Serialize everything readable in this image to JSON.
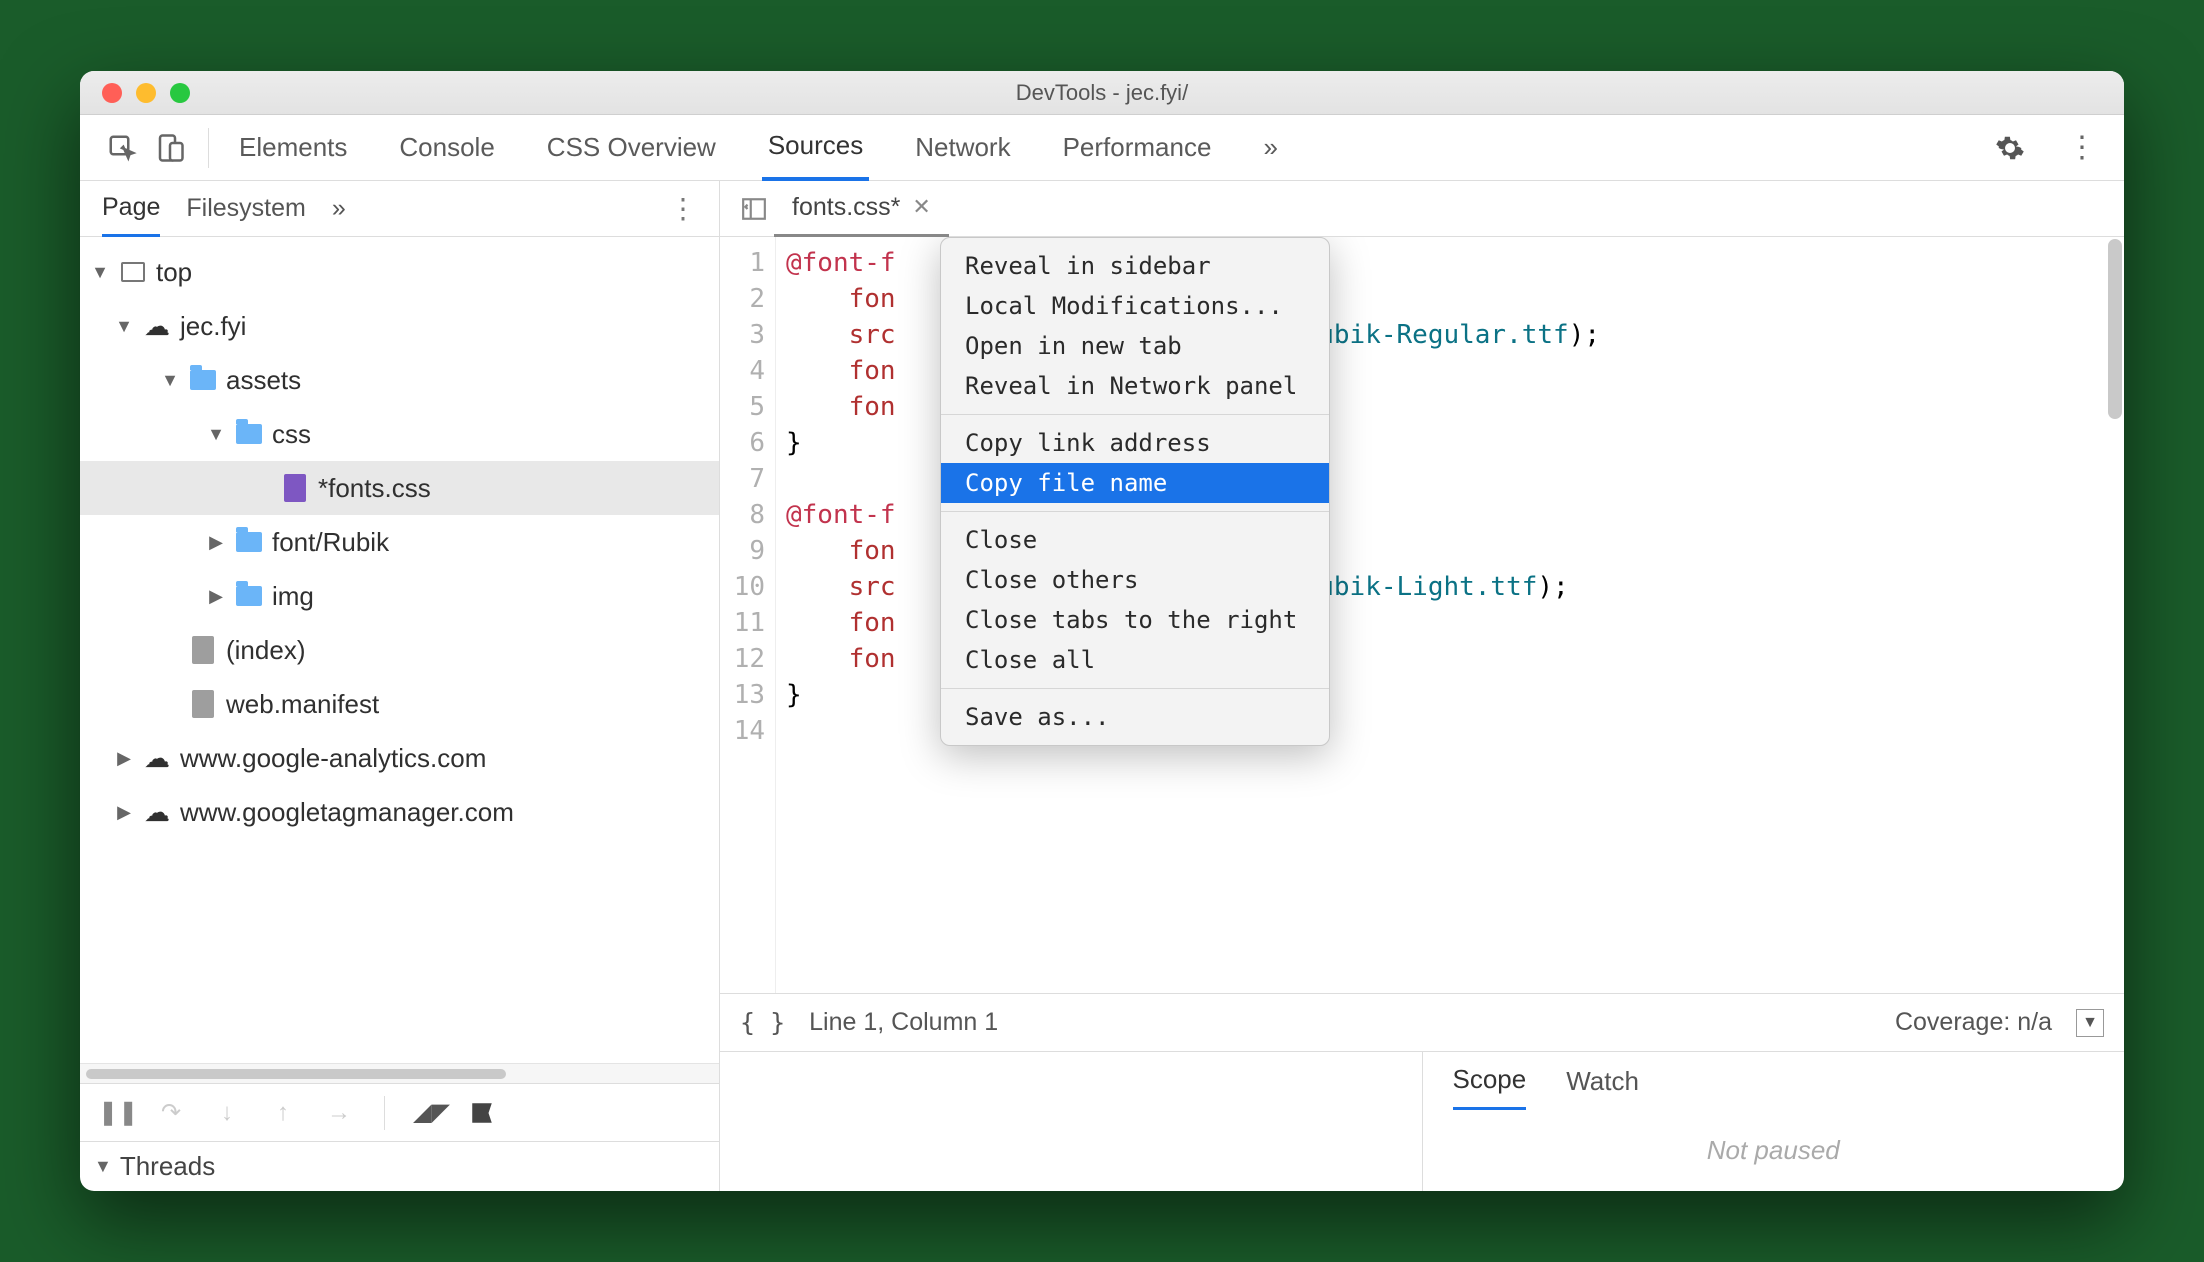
{
  "window": {
    "title": "DevTools - jec.fyi/"
  },
  "toolbar": {
    "tabs": [
      "Elements",
      "Console",
      "CSS Overview",
      "Sources",
      "Network",
      "Performance"
    ],
    "active": "Sources",
    "more": "»"
  },
  "sidebar": {
    "tabs": [
      "Page",
      "Filesystem"
    ],
    "active": "Page",
    "more": "»",
    "tree": {
      "top": "top",
      "domain": "jec.fyi",
      "folders": {
        "assets": "assets",
        "css": "css",
        "font": "font/Rubik",
        "img": "img"
      },
      "files": {
        "fonts": "*fonts.css",
        "index": "(index)",
        "manifest": "web.manifest"
      },
      "externals": [
        "www.google-analytics.com",
        "www.googletagmanager.com"
      ]
    }
  },
  "editor": {
    "tab": "fonts.css*",
    "gutter": [
      "1",
      "2",
      "3",
      "4",
      "5",
      "6",
      "7",
      "8",
      "9",
      "10",
      "11",
      "12",
      "13",
      "14"
    ],
    "code_lines": [
      {
        "kw": "@font-f"
      },
      {
        "prop": "fon"
      },
      {
        "prop": "src",
        "tail": "Rubik/Rubik-Regular.ttf"
      },
      {
        "prop": "fon"
      },
      {
        "prop": "fon"
      },
      {
        "brace": "}"
      },
      {
        "blank": ""
      },
      {
        "kw": "@font-f"
      },
      {
        "prop": "fon"
      },
      {
        "prop": "src",
        "tail": "Rubik/Rubik-Light.ttf"
      },
      {
        "prop": "fon"
      },
      {
        "prop": "fon"
      },
      {
        "brace": "}"
      },
      {
        "blank": ""
      }
    ]
  },
  "statusbar": {
    "braces": "{ }",
    "pos": "Line 1, Column 1",
    "coverage": "Coverage: n/a"
  },
  "context_menu": {
    "items": [
      [
        "Reveal in sidebar",
        "Local Modifications...",
        "Open in new tab",
        "Reveal in Network panel"
      ],
      [
        "Copy link address",
        "Copy file name"
      ],
      [
        "Close",
        "Close others",
        "Close tabs to the right",
        "Close all"
      ],
      [
        "Save as..."
      ]
    ],
    "highlighted": "Copy file name"
  },
  "bottom": {
    "tabs": [
      "Scope",
      "Watch"
    ],
    "active": "Scope",
    "status": "Not paused"
  },
  "threads": {
    "label": "Threads"
  }
}
